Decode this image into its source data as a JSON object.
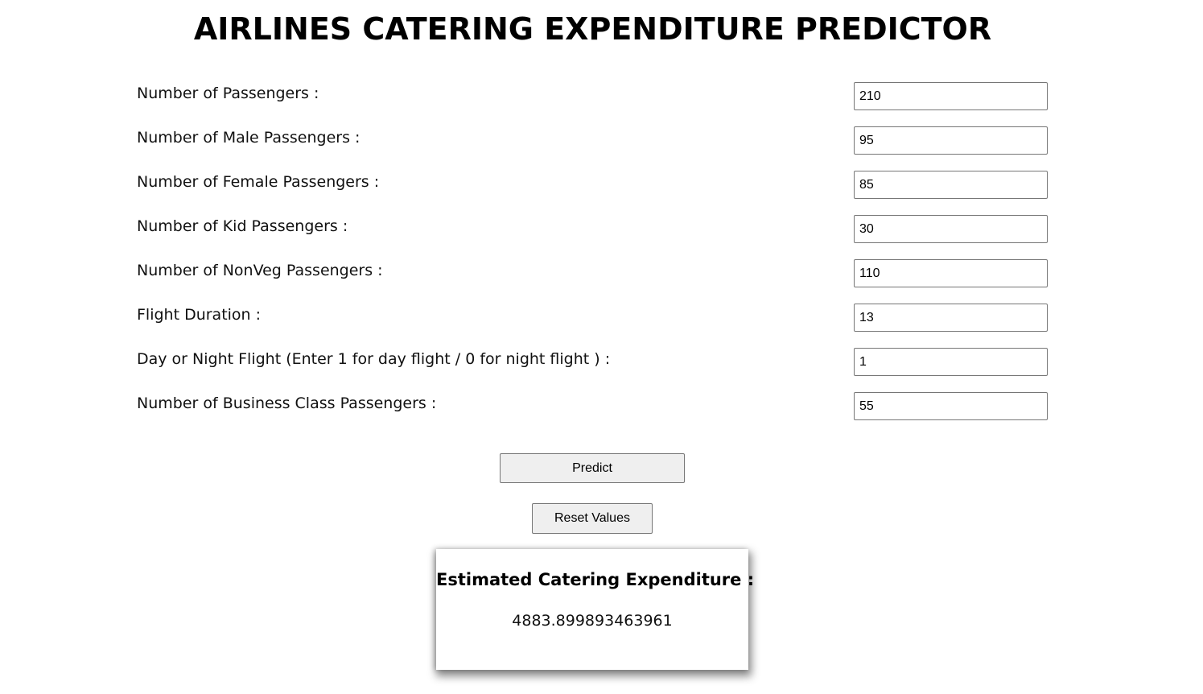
{
  "page": {
    "title": "AIRLINES CATERING EXPENDITURE PREDICTOR"
  },
  "form": {
    "fields": [
      {
        "label": "Number of Passengers :",
        "value": "210"
      },
      {
        "label": "Number of Male Passengers :",
        "value": "95"
      },
      {
        "label": "Number of Female Passengers :",
        "value": "85"
      },
      {
        "label": "Number of Kid Passengers :",
        "value": "30"
      },
      {
        "label": "Number of NonVeg Passengers :",
        "value": "110"
      },
      {
        "label": "Flight Duration :",
        "value": "13"
      },
      {
        "label": "Day or Night Flight (Enter 1 for day flight / 0 for night flight ) :",
        "value": "1"
      },
      {
        "label": "Number of Business Class Passengers :",
        "value": "55"
      }
    ],
    "predict_label": "Predict",
    "reset_label": "Reset Values"
  },
  "result": {
    "heading": "Estimated Catering Expenditure :",
    "value": "4883.899893463961"
  }
}
